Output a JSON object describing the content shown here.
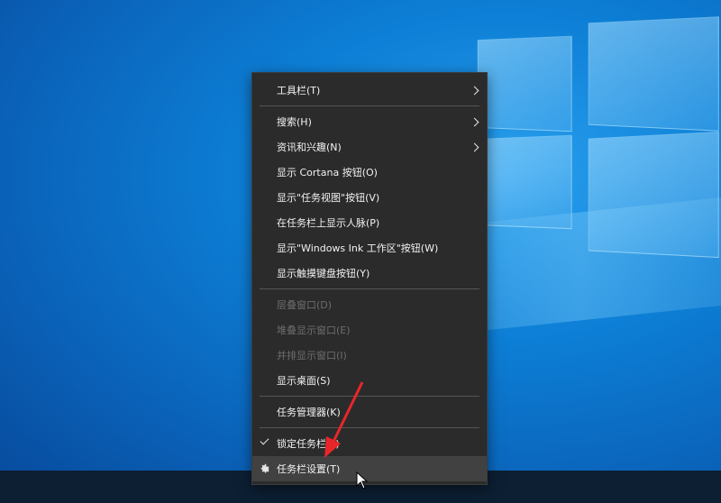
{
  "menu": {
    "toolbar": "工具栏(T)",
    "search": "搜索(H)",
    "news": "资讯和兴趣(N)",
    "cortana": "显示 Cortana 按钮(O)",
    "taskview": "显示\"任务视图\"按钮(V)",
    "people": "在任务栏上显示人脉(P)",
    "ink": "显示\"Windows Ink 工作区\"按钮(W)",
    "touchkb": "显示触摸键盘按钮(Y)",
    "cascade": "层叠窗口(D)",
    "stack": "堆叠显示窗口(E)",
    "sidebyside": "并排显示窗口(I)",
    "showdesktop": "显示桌面(S)",
    "taskmgr": "任务管理器(K)",
    "lock": "锁定任务栏(L)",
    "settings": "任务栏设置(T)"
  },
  "icons": {
    "submenu": "chevron-right-icon",
    "checked": "checkmark-icon",
    "settings": "gear-icon",
    "pointer": "mouse-cursor-icon",
    "annotation": "red-arrow-icon"
  },
  "colors": {
    "menu_bg": "#2b2b2b",
    "menu_text": "#f2f2f2",
    "disabled_text": "#6d6d6d",
    "hover_bg": "#414141",
    "annotation_arrow": "#e8262a",
    "desktop_blue": "#0a70cc"
  }
}
